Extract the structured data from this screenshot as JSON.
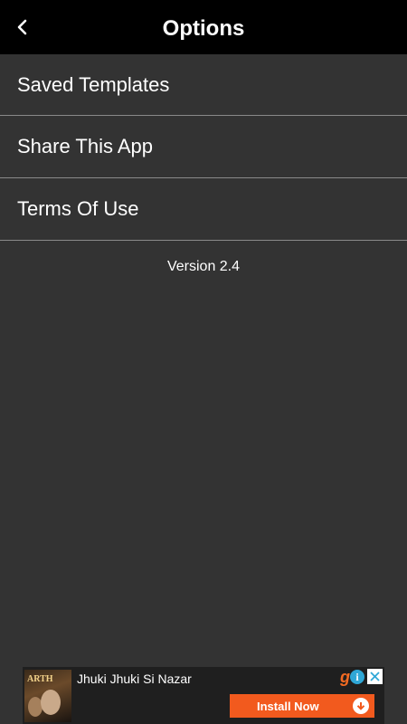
{
  "header": {
    "title": "Options",
    "back_icon": "chevron-left-icon"
  },
  "menu": {
    "items": [
      {
        "label": "Saved Templates"
      },
      {
        "label": "Share This App"
      },
      {
        "label": "Terms Of Use"
      }
    ]
  },
  "version": "Version 2.4",
  "ad": {
    "thumb_label": "ARTH",
    "title": "Jhuki Jhuki Si Nazar",
    "brand_letter": "g",
    "info_icon": "i",
    "install_label": "Install Now",
    "colors": {
      "install_bg": "#f25a1e",
      "info_bg": "#2fa7d6"
    }
  },
  "colors": {
    "background": "#333333",
    "header_bg": "#000000",
    "divider": "#8a8a8a",
    "text": "#ffffff"
  }
}
